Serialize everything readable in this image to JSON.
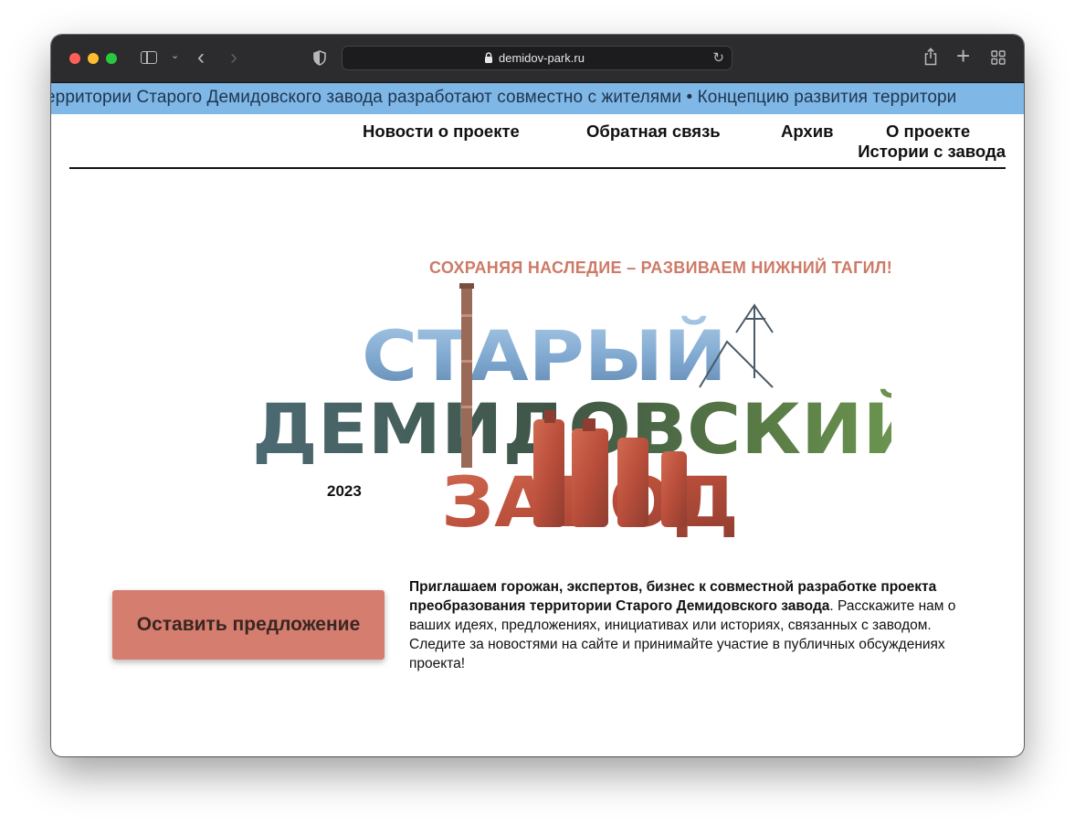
{
  "browser": {
    "url": "demidov-park.ru"
  },
  "ticker": {
    "text": "ерритории Старого Демидовского завода разработают совместно с жителями  •  Концепцию развития территори"
  },
  "nav": {
    "items": [
      "Новости о проекте",
      "Обратная связь",
      "Архив",
      "О проекте",
      "Истории с завода"
    ]
  },
  "hero": {
    "slogan": "СОХРАНЯЯ НАСЛЕДИЕ – РАЗВИВАЕМ НИЖНИЙ ТАГИЛ!",
    "title_lines": [
      "СТАРЫЙ",
      "ДЕМИДОВСКИЙ",
      "ЗАВОД"
    ],
    "year": "2023"
  },
  "cta": {
    "label": "Оставить предложение"
  },
  "intro": {
    "bold": "Приглашаем горожан, экспертов, бизнес к совместной разработке проекта преобразования территории Старого Демидовского завода",
    "rest": ". Расскажите нам о ваших идеях, предложениях, инициативах или историях, связанных с заводом. Следите за новостями на сайте и принимайте участие в публичных обсуждениях проекта!"
  },
  "colors": {
    "ticker_bg": "#7fb7e6",
    "slogan": "#cd7a66",
    "cta_bg": "#d57d6f",
    "sky": "#8ab4d8",
    "forest": "#3f5b48",
    "rust": "#c65a44"
  },
  "icons": [
    "sidebar-icon",
    "chevron-down-icon",
    "back-arrow-icon",
    "forward-arrow-icon",
    "shield-icon",
    "lock-icon",
    "reload-icon",
    "share-icon",
    "plus-icon",
    "tab-overview-icon"
  ]
}
